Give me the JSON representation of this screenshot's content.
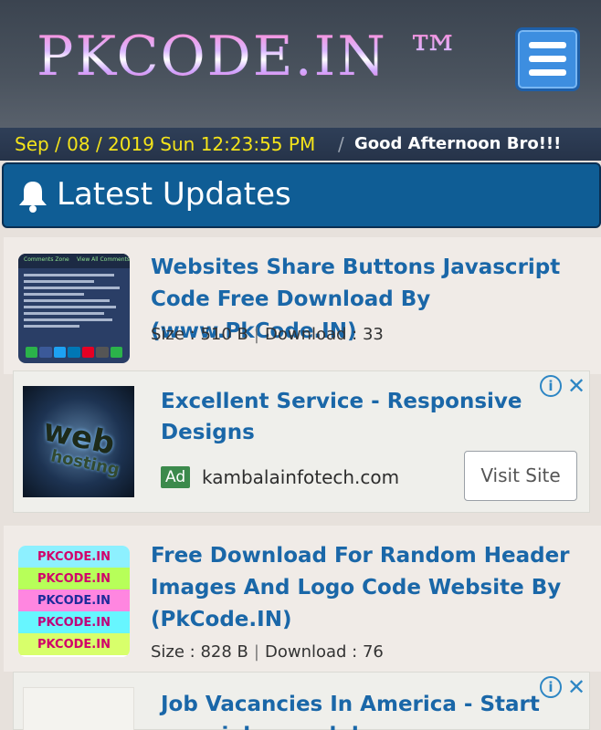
{
  "header": {
    "logo": "PKCODE.IN ™"
  },
  "datebar": {
    "date": "Sep / 08 / 2019 Sun 12:23:55 PM",
    "separator": "/",
    "greeting": "Good Afternoon Bro!!!"
  },
  "section": {
    "title": "Latest Updates",
    "icon": "bell-icon"
  },
  "posts": [
    {
      "title": "Websites Share Buttons Javascript Code Free Download By (www.PkCode.IN)",
      "size_label": "Size : 510 B",
      "download_label": "Download : 33",
      "thumb_left": "Comments Zone",
      "thumb_right": "View All Comments"
    },
    {
      "title": "Free Download For Random Header Images And Logo Code Website By (PkCode.IN)",
      "size_label": "Size : 828 B",
      "download_label": "Download : 76",
      "thumb_text": "PKCODE.IN"
    }
  ],
  "ads": [
    {
      "title": "Excellent Service - Responsive Designs",
      "badge": "Ad",
      "domain": "kambalainfotech.com",
      "cta": "Visit Site",
      "image_text_1": "web",
      "image_text_2": "hosting"
    },
    {
      "title": "Job Vacancies In America - Start your job search here"
    }
  ],
  "colors": {
    "accent_blue": "#1a67a8",
    "date_yellow": "#f4e31a",
    "section_bg": "#0f5d95",
    "ad_green": "#3c8a4c"
  }
}
